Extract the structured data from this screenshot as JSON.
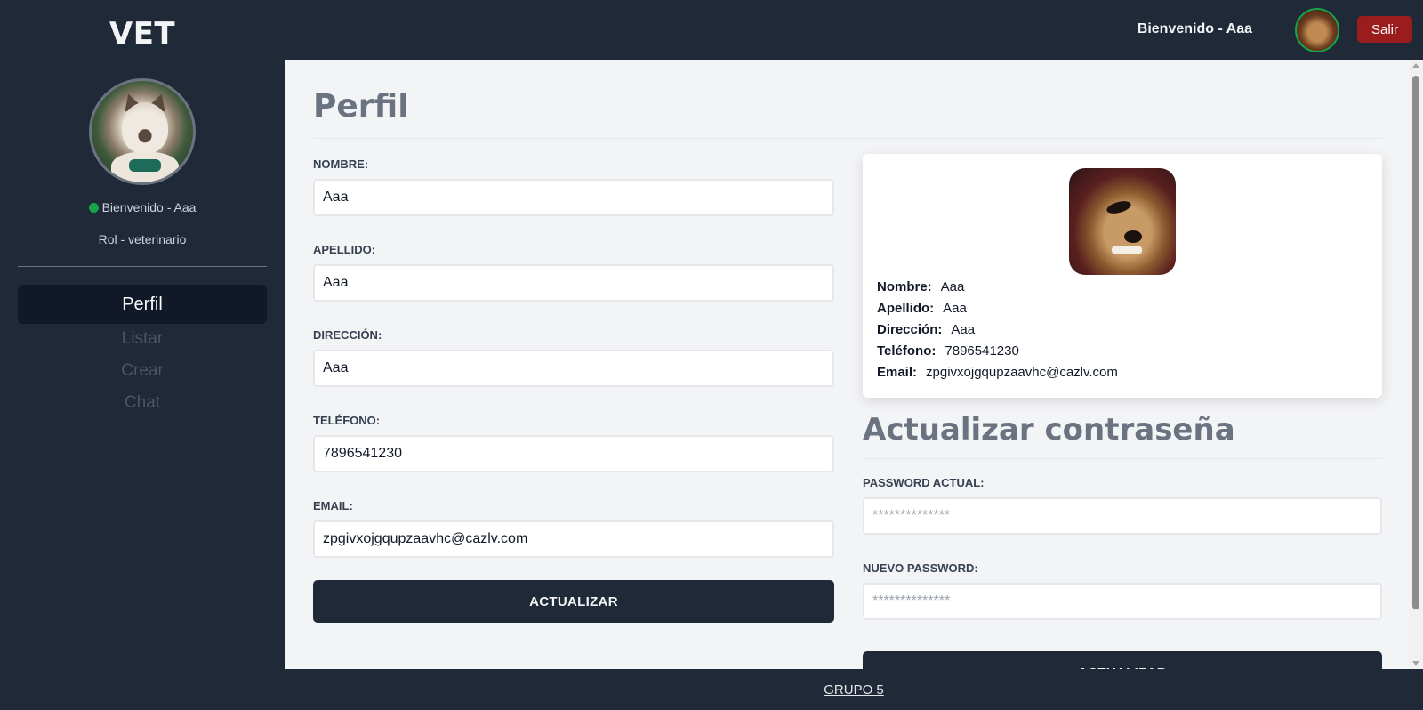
{
  "app": {
    "logo": "VET"
  },
  "sidebar": {
    "welcome": "Bienvenido - Aaa",
    "role": "Rol - veterinario",
    "nav": [
      {
        "label": "Perfil",
        "active": true
      },
      {
        "label": "Listar",
        "active": false
      },
      {
        "label": "Crear",
        "active": false
      },
      {
        "label": "Chat",
        "active": false
      }
    ]
  },
  "topbar": {
    "welcome": "Bienvenido - Aaa",
    "logout_label": "Salir"
  },
  "profile": {
    "title": "Perfil",
    "fields": {
      "nombre": {
        "label": "NOMBRE:",
        "value": "Aaa"
      },
      "apellido": {
        "label": "APELLIDO:",
        "value": "Aaa"
      },
      "direccion": {
        "label": "DIRECCIÓN:",
        "value": "Aaa"
      },
      "telefono": {
        "label": "TELÉFONO:",
        "value": "7896541230"
      },
      "email": {
        "label": "EMAIL:",
        "value": "zpgivxojgqupzaavhc@cazlv.com"
      }
    },
    "update_label": "ACTUALIZAR"
  },
  "card": {
    "rows": [
      {
        "key": "Nombre:",
        "value": "Aaa"
      },
      {
        "key": "Apellido:",
        "value": "Aaa"
      },
      {
        "key": "Dirección:",
        "value": "Aaa"
      },
      {
        "key": "Teléfono:",
        "value": "7896541230"
      },
      {
        "key": "Email:",
        "value": "zpgivxojgqupzaavhc@cazlv.com"
      }
    ]
  },
  "password": {
    "title": "Actualizar contraseña",
    "current": {
      "label": "PASSWORD ACTUAL:",
      "placeholder": "**************"
    },
    "new": {
      "label": "NUEVO PASSWORD:",
      "placeholder": "**************"
    },
    "update_label": "ACTUALIZAR"
  },
  "footer": {
    "link": "GRUPO 5"
  },
  "colors": {
    "sidebar_bg": "#1f2937",
    "main_bg": "#f3f4f6",
    "button_dark": "#1f2937",
    "logout_red": "#9b1c1c",
    "online_green": "#16a34a"
  }
}
